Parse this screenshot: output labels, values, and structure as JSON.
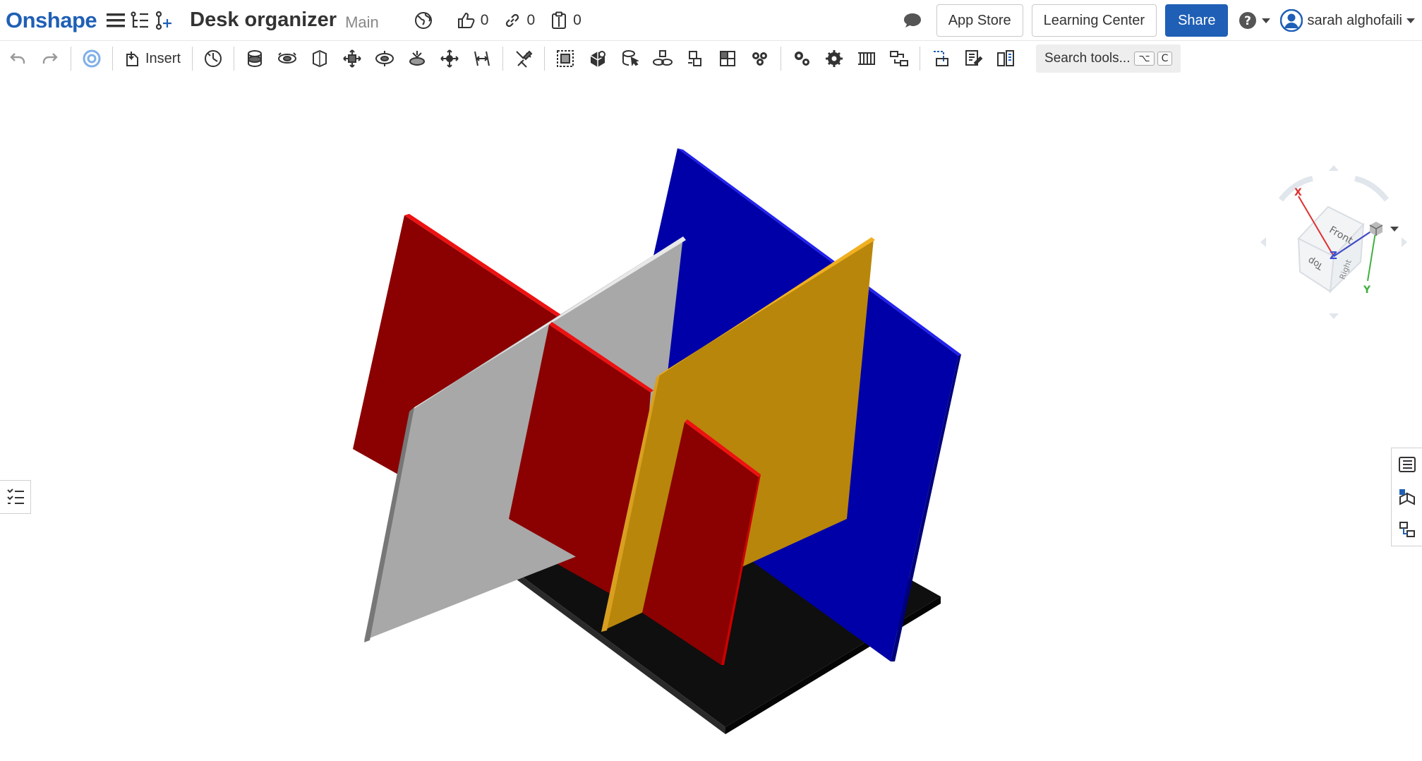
{
  "app": {
    "logo": "Onshape",
    "document_title": "Desk organizer",
    "branch": "Main"
  },
  "header": {
    "likes": "0",
    "links": "0",
    "copies": "0",
    "app_store": "App Store",
    "learning_center": "Learning Center",
    "share": "Share",
    "user_name": "sarah alghofaili"
  },
  "toolbar": {
    "insert_label": "Insert",
    "search_label": "Search tools...",
    "search_key_1": "⌥",
    "search_key_2": "C"
  },
  "icons": {
    "menu": "hamburger-icon",
    "feature_list": "feature-tree-icon",
    "add_branch": "branch-add-icon",
    "public": "globe-icon",
    "like": "thumbs-up-icon",
    "link": "link-icon",
    "copy": "clipboard-icon",
    "comment": "comment-icon",
    "help": "help-icon",
    "user": "user-avatar-icon"
  },
  "colors": {
    "brand": "#1f5fb5",
    "part_red": "#8b0000",
    "part_blue": "#0000a8",
    "part_gray": "#a8a8a8",
    "part_yellow": "#b8860b",
    "part_black": "#111111"
  },
  "viewcube": {
    "front": "Front",
    "top": "Top",
    "right": "Right",
    "axis_x": "X",
    "axis_y": "Y",
    "axis_z": "Z"
  }
}
